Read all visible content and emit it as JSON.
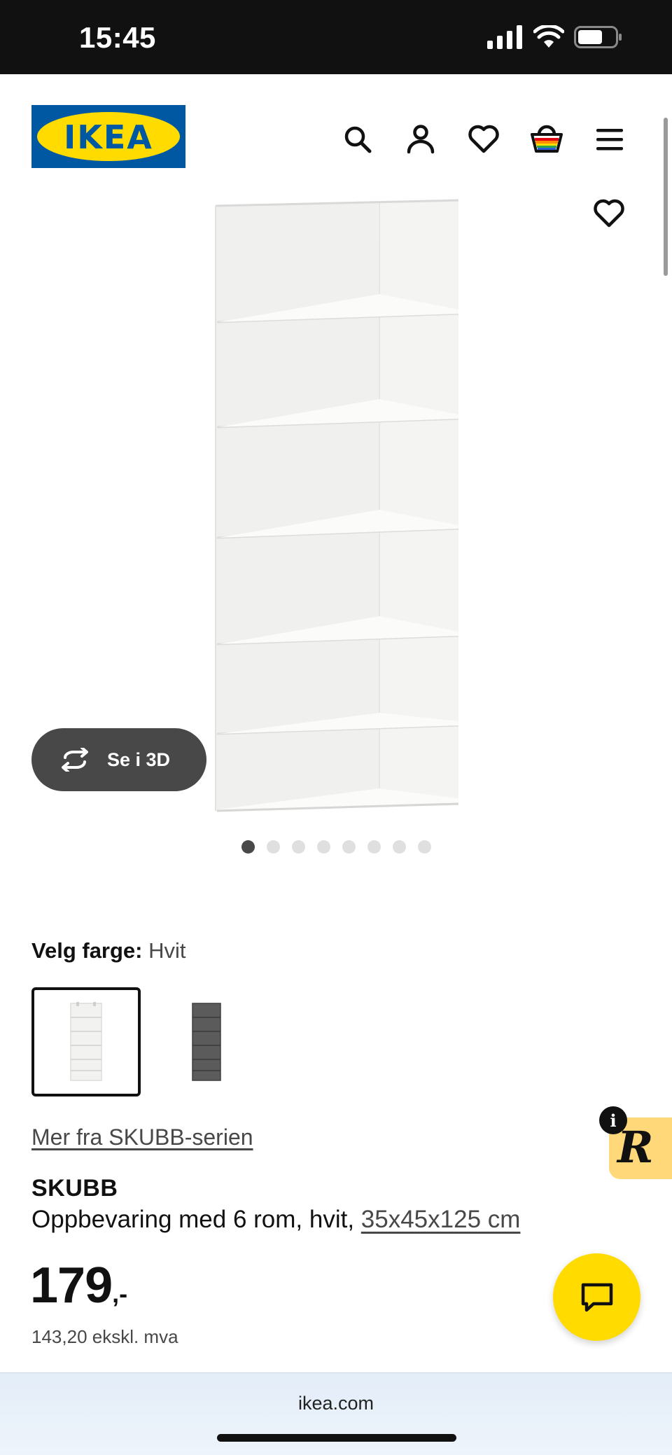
{
  "status_bar": {
    "time": "15:45"
  },
  "header": {
    "logo_text": "IKEA",
    "icons": [
      "search-icon",
      "user-icon",
      "heart-icon",
      "basket-icon",
      "menu-icon"
    ]
  },
  "gallery": {
    "view_3d_label": "Se i 3D",
    "image_count": 8,
    "active_index": 0
  },
  "color_picker": {
    "label": "Velg farge:",
    "selected_value": "Hvit",
    "options": [
      "white",
      "dark-grey"
    ]
  },
  "series_link": "Mer fra SKUBB-serien",
  "product": {
    "name": "SKUBB",
    "description": "Oppbevaring med 6 rom, hvit, ",
    "size_link": "35x45x125 cm",
    "price_integer": "179",
    "price_suffix": ",-",
    "price_ex_vat": "143,20 ekskl. mva"
  },
  "widgets": {
    "info_letter": "i",
    "r_logo": "R"
  },
  "browser": {
    "url": "ikea.com"
  },
  "colors": {
    "ikea_blue": "#0058a3",
    "ikea_yellow": "#ffdb00",
    "dark_grey": "#484848"
  }
}
